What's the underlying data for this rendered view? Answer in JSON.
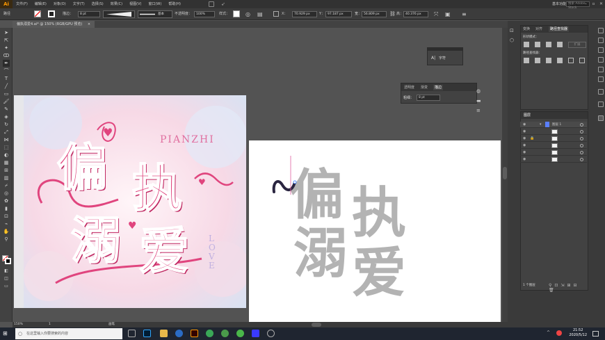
{
  "app": {
    "logo": "Ai"
  },
  "menu": [
    "文件(F)",
    "编辑(E)",
    "对象(O)",
    "文字(T)",
    "选择(S)",
    "效果(C)",
    "视图(V)",
    "窗口(W)",
    "帮助(H)"
  ],
  "workspace": "基本功能",
  "search_placeholder": "搜索 Adobe Stock",
  "control": {
    "selection_label": "路径",
    "stroke_label": "描边：",
    "stroke_value": "8 pt",
    "brush_label": "基本",
    "opacity_label": "不透明度：",
    "opacity_value": "100%",
    "style_label": "样式：",
    "x_label": "X：",
    "x_value": "70.929 px",
    "y_label": "Y：",
    "y_value": "97.187 px",
    "w_label": "宽：",
    "w_value": "56.809 px",
    "h_label": "高：",
    "h_value": "40.376 px"
  },
  "document_tab": "偏执溺爱4.ai* @ 150% (RGB/GPU 预览)",
  "artwork": {
    "pianzhi": "PIANZHI",
    "love": "LOVE",
    "title_chars": [
      "偏",
      "执",
      "溺",
      "爱"
    ]
  },
  "char_panel": {
    "label": "字符"
  },
  "stroke_panel": {
    "tabs": [
      "透明度",
      "渐变",
      "描边"
    ],
    "weight_label": "粗细：",
    "weight_value": "8 pt"
  },
  "top_panel": {
    "tabs": [
      "变换",
      "对齐",
      "路径查找器"
    ],
    "shape_modes_label": "形状模式：",
    "pathfinder_label": "路径查找器：",
    "expand_button": "扩展"
  },
  "layers_panel": {
    "tab": "图层",
    "layer_name": "图层 1",
    "rows": 7,
    "footer": "1 个图层"
  },
  "status": {
    "zoom": "150%",
    "page": "1",
    "mode": "画笔"
  },
  "taskbar": {
    "search_placeholder": "在这里输入你要搜索的内容",
    "time": "21:52",
    "date": "2020/5/12"
  },
  "colors": {
    "accent": "#ff9a00",
    "pink": "#e0457e",
    "glyph_gray": "#b3b3b3"
  }
}
